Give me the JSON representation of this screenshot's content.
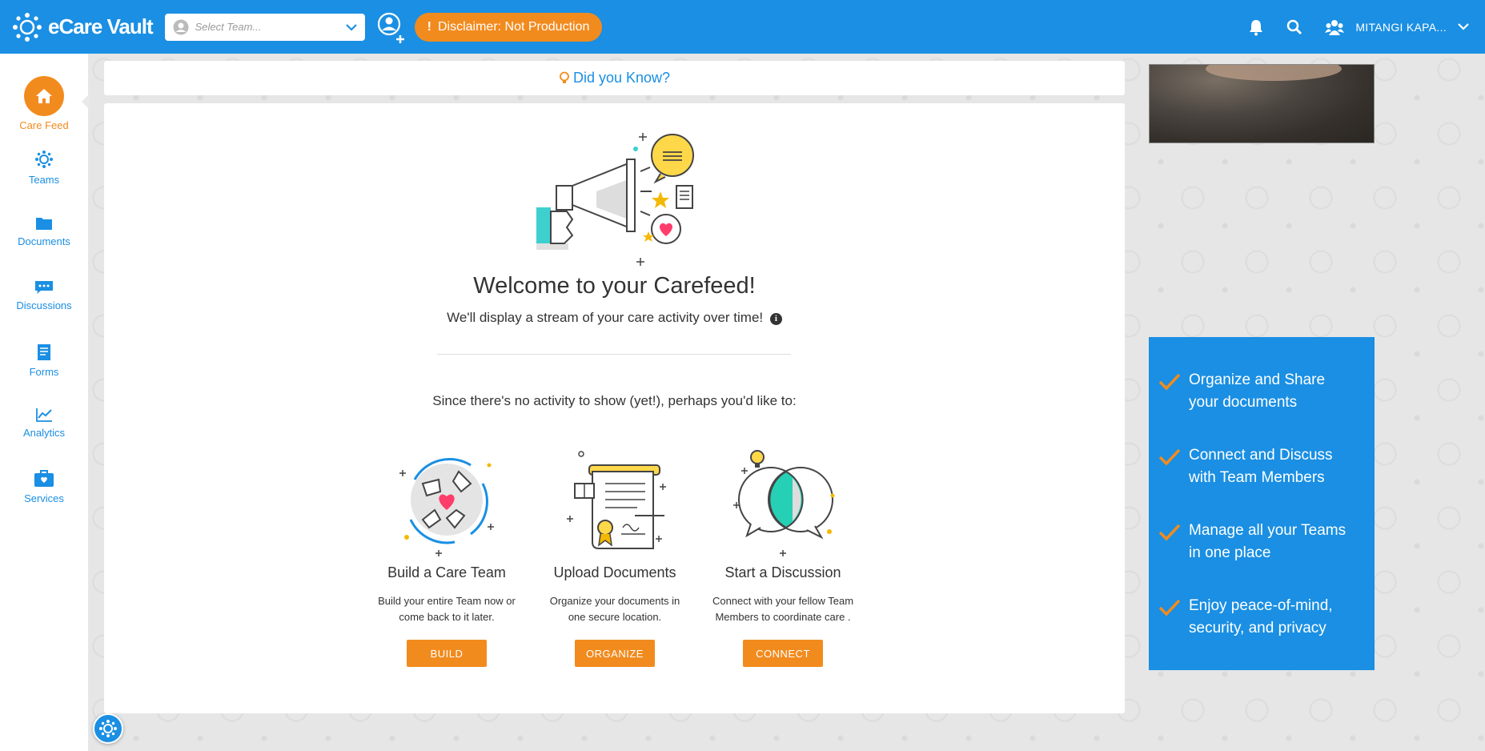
{
  "header": {
    "logo_text": "eCare Vault",
    "team_select_placeholder": "Select Team...",
    "disclaimer": "Disclaimer: Not Production",
    "user_name": "MITANGI KAPA...",
    "accent_color": "#1a8fe3",
    "brand_orange": "#f28b1e"
  },
  "sidebar": {
    "items": [
      {
        "label": "Care Feed",
        "icon": "home-icon",
        "active": true
      },
      {
        "label": "Teams",
        "icon": "teams-icon"
      },
      {
        "label": "Documents",
        "icon": "folder-icon"
      },
      {
        "label": "Discussions",
        "icon": "chat-icon"
      },
      {
        "label": "Forms",
        "icon": "form-icon"
      },
      {
        "label": "Analytics",
        "icon": "chart-icon"
      },
      {
        "label": "Services",
        "icon": "briefcase-icon"
      }
    ]
  },
  "tip": {
    "label": "Did you Know?"
  },
  "feed": {
    "title": "Welcome to your Carefeed!",
    "subtitle": "We'll display a stream of your care activity over time!",
    "prompt": "Since there's no activity to show (yet!), perhaps you'd like to:",
    "options": [
      {
        "title": "Build a Care Team",
        "desc_line1": "Build your entire Team now or",
        "desc_line2": "come back to it later.",
        "button": "BUILD"
      },
      {
        "title": "Upload Documents",
        "desc_line1": "Organize your documents in",
        "desc_line2": "one secure location.",
        "button": "ORGANIZE"
      },
      {
        "title": "Start a Discussion",
        "desc_line1": "Connect with your fellow Team",
        "desc_line2": "Members to coordinate care .",
        "button": "CONNECT"
      }
    ]
  },
  "features": [
    {
      "line1": "Organize and Share",
      "line2": "your documents"
    },
    {
      "line1": "Connect and Discuss",
      "line2": "with Team Members"
    },
    {
      "line1": "Manage all your Teams",
      "line2": "in one place"
    },
    {
      "line1": "Enjoy peace-of-mind,",
      "line2": "security, and privacy"
    }
  ]
}
